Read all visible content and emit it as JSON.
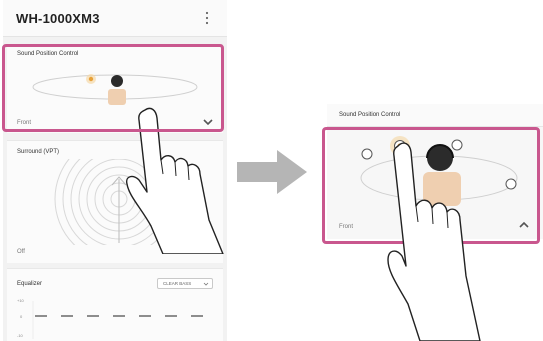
{
  "app": {
    "title": "WH-1000XM3",
    "menu_icon": "kebab-menu-icon"
  },
  "sound_position": {
    "label": "Sound Position Control",
    "value": "Front",
    "expand_icon": "chevron-down-icon",
    "collapse_icon": "chevron-up-icon"
  },
  "surround": {
    "label": "Surround (VPT)",
    "value": "Off",
    "expand_icon": "chevron-down-icon"
  },
  "equalizer": {
    "label": "Equalizer",
    "preset": "CLEAR BASS",
    "axis_ticks": [
      "+10",
      "0",
      "-10"
    ]
  },
  "colors": {
    "highlight": "#c9578e",
    "arrow": "#b5b5b5",
    "selected_position": "#e8a23a"
  }
}
